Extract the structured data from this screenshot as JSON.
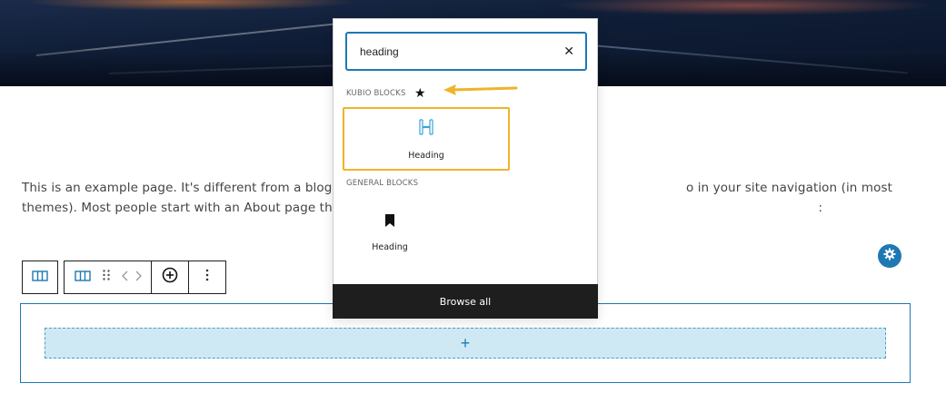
{
  "page": {
    "paragraph_text": "This is an example page. It's different from a blog post b                                                                              o in your site navigation (in most themes). Most people start with an About page that introduces them to poten                                                                              :"
  },
  "inserter": {
    "search_value": "heading",
    "clear_icon": "close-icon",
    "kubio_category": "KUBIO BLOCKS",
    "general_category": "GENERAL BLOCKS",
    "kubio_block_label": "Heading",
    "general_block_label": "Heading",
    "browse_all_label": "Browse all"
  },
  "appender": {
    "label": "+"
  },
  "colors": {
    "accent": "#1e78b4",
    "highlight": "#f0b429",
    "appender_bg": "#cfe9f4",
    "dark": "#1e1e1e"
  }
}
